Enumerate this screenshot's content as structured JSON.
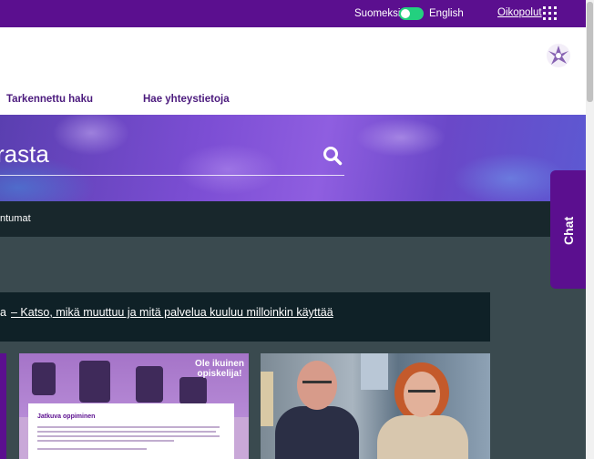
{
  "topbar": {
    "lang_fi": "Suomeksi",
    "lang_en": "English",
    "shortcuts": "Oikopolut"
  },
  "nav": {
    "items": [
      {
        "label": "Tarkennettu haku"
      },
      {
        "label": "Hae yhteystietoja"
      }
    ]
  },
  "search": {
    "value": "rasta"
  },
  "darkbar": {
    "text": "ntumat"
  },
  "notice": {
    "prefix": "a",
    "link": "– Katso, mikä muuttuu ja mitä palvelua kuuluu milloinkin käyttää"
  },
  "chat": {
    "label": "Chat"
  },
  "cards": [
    {
      "headline": "Ole ikuinen opiskelija!",
      "paper_title": "Jatkuva oppiminen"
    },
    {
      "image": "two-people-photo"
    }
  ],
  "colors": {
    "brand_purple": "#5b0f8f",
    "nav_text": "#4b1a7d",
    "dark_bar": "#18272c",
    "page_bg": "#3a4a4f",
    "toggle_on": "#23d07f"
  }
}
